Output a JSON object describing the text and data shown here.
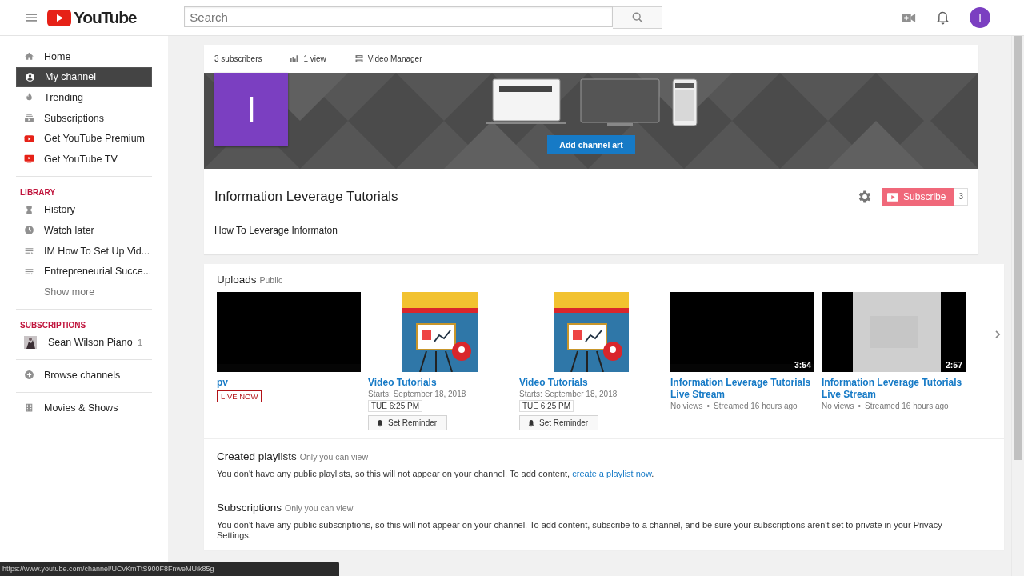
{
  "header": {
    "brand": "YouTube",
    "search_placeholder": "Search",
    "avatar_letter": "I"
  },
  "sidebar": {
    "main": [
      {
        "label": "Home",
        "selected": false
      },
      {
        "label": "My channel",
        "selected": true
      },
      {
        "label": "Trending",
        "selected": false
      },
      {
        "label": "Subscriptions",
        "selected": false
      },
      {
        "label": "Get YouTube Premium",
        "selected": false
      },
      {
        "label": "Get YouTube TV",
        "selected": false
      }
    ],
    "library_heading": "LIBRARY",
    "library": [
      {
        "label": "History",
        "selected": false
      },
      {
        "label": "Watch later",
        "selected": false
      },
      {
        "label": "IM How To Set Up Vid...",
        "selected": false
      },
      {
        "label": "Entrepreneurial Succe...",
        "selected": false
      }
    ],
    "show_more": "Show more",
    "subscriptions_heading": "SUBSCRIPTIONS",
    "subscriptions": [
      {
        "label": "Sean Wilson Piano",
        "count": "1"
      }
    ],
    "browse": "Browse channels",
    "movies": "Movies & Shows"
  },
  "channel": {
    "subscribers": "3 subscribers",
    "views": "1 view",
    "manager": "Video Manager",
    "avatar_letter": "I",
    "add_art": "Add channel art",
    "name": "Information Leverage Tutorials",
    "subscribe": "Subscribe",
    "subscribe_count": "3",
    "description": "How To Leverage Informaton"
  },
  "uploads": {
    "title": "Uploads",
    "badge": "Public",
    "videos": [
      {
        "kind": "live",
        "title": "pv",
        "live": "LIVE NOW"
      },
      {
        "kind": "scheduled",
        "title": "Video Tutorials",
        "starts": "Starts: September 18, 2018",
        "time": "TUE 6:25 PM",
        "reminder": "Set Reminder"
      },
      {
        "kind": "scheduled",
        "title": "Video Tutorials",
        "starts": "Starts: September 18, 2018",
        "time": "TUE 6:25 PM",
        "reminder": "Set Reminder"
      },
      {
        "kind": "streamed",
        "duration": "3:54",
        "title": "Information Leverage Tutorials Live Stream",
        "views": "No views",
        "separator": "•",
        "streamed": "Streamed 16 hours ago"
      },
      {
        "kind": "streamed",
        "duration": "2:57",
        "title": "Information Leverage Tutorials Live Stream",
        "views": "No views",
        "separator": "•",
        "streamed": "Streamed 16 hours ago"
      }
    ]
  },
  "playlists": {
    "title": "Created playlists",
    "note": "Only you can view",
    "text": "You don't have any public playlists, so this will not appear on your channel. To add content, ",
    "link": "create a playlist now",
    "end": "."
  },
  "subscriptions_section": {
    "title": "Subscriptions",
    "note": "Only you can view",
    "text": "You don't have any public subscriptions, so this will not appear on your channel. To add content, subscribe to a channel, and be sure your subscriptions aren't set to private in your Privacy Settings."
  },
  "status_url": "https://www.youtube.com/channel/UCvKmTtS900F8FnweMUik85g"
}
